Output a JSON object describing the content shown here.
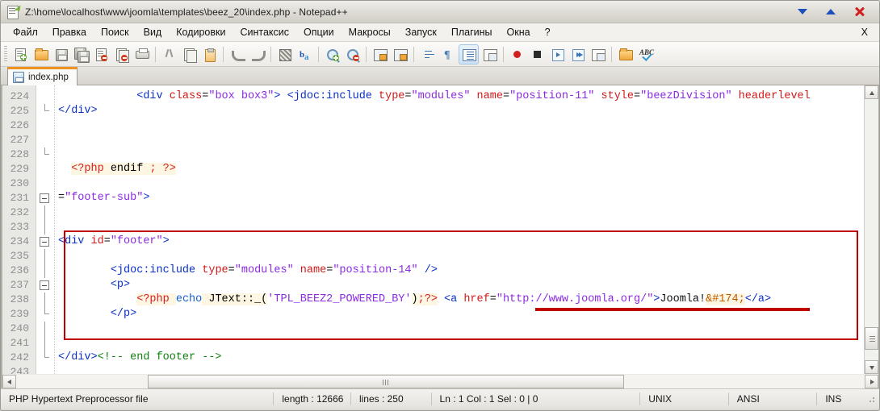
{
  "window": {
    "title": "Z:\\home\\localhost\\www\\joomla\\templates\\beez_20\\index.php - Notepad++",
    "icon": "notepad-plus-plus-icon",
    "controls": {
      "minimize": "▼",
      "maximize": "▲",
      "close": "✕"
    },
    "accent_colors": {
      "tab_active_top": "#f0921e",
      "annotation_red": "#c00000",
      "minimize_blue": "#1c4fbe",
      "close_red": "#cf2020"
    }
  },
  "menubar": {
    "items": [
      {
        "label": "Файл"
      },
      {
        "label": "Правка"
      },
      {
        "label": "Поиск"
      },
      {
        "label": "Вид"
      },
      {
        "label": "Кодировки"
      },
      {
        "label": "Синтаксис"
      },
      {
        "label": "Опции"
      },
      {
        "label": "Макросы"
      },
      {
        "label": "Запуск"
      },
      {
        "label": "Плагины"
      },
      {
        "label": "Окна"
      },
      {
        "label": "?"
      }
    ],
    "right_label": "X"
  },
  "toolbar": {
    "buttons": [
      {
        "name": "new-file-icon"
      },
      {
        "name": "open-file-icon"
      },
      {
        "name": "save-icon"
      },
      {
        "name": "save-all-icon"
      },
      {
        "name": "close-file-icon"
      },
      {
        "name": "close-all-icon"
      },
      {
        "name": "print-icon"
      },
      {
        "name": "cut-icon"
      },
      {
        "name": "copy-icon"
      },
      {
        "name": "paste-icon"
      },
      {
        "name": "undo-icon"
      },
      {
        "name": "redo-icon"
      },
      {
        "name": "find-icon"
      },
      {
        "name": "replace-icon"
      },
      {
        "name": "zoom-in-icon"
      },
      {
        "name": "zoom-out-icon"
      },
      {
        "name": "sync-vertical-icon"
      },
      {
        "name": "sync-horizontal-icon"
      },
      {
        "name": "word-wrap-icon"
      },
      {
        "name": "show-all-chars-icon"
      },
      {
        "name": "indent-guide-icon"
      },
      {
        "name": "user-defined-dialog-icon"
      },
      {
        "name": "record-macro-icon"
      },
      {
        "name": "stop-recording-icon"
      },
      {
        "name": "play-macro-icon"
      },
      {
        "name": "run-macro-multiple-icon"
      },
      {
        "name": "save-macro-icon"
      },
      {
        "name": "run-icon"
      },
      {
        "name": "spell-check-icon"
      }
    ]
  },
  "tabs": [
    {
      "label": "index.php",
      "icon": "saved-file-icon",
      "active": true
    }
  ],
  "editor": {
    "first_line": 224,
    "lines": [
      {
        "num": "224",
        "fold": "none",
        "segments": [
          {
            "t": "            ",
            "c": "k-plain"
          },
          {
            "t": "<div",
            "c": "k-tag"
          },
          {
            "t": " class",
            "c": "k-attr"
          },
          {
            "t": "=",
            "c": "k-punct"
          },
          {
            "t": "\"box box3\"",
            "c": "k-str"
          },
          {
            "t": ">",
            "c": "k-tag"
          },
          {
            "t": " ",
            "c": "k-plain"
          },
          {
            "t": "<jdoc:include",
            "c": "k-tag"
          },
          {
            "t": " type",
            "c": "k-attr"
          },
          {
            "t": "=",
            "c": "k-punct"
          },
          {
            "t": "\"modules\"",
            "c": "k-str"
          },
          {
            "t": " name",
            "c": "k-attr"
          },
          {
            "t": "=",
            "c": "k-punct"
          },
          {
            "t": "\"position-11\"",
            "c": "k-str"
          },
          {
            "t": " style",
            "c": "k-attr"
          },
          {
            "t": "=",
            "c": "k-punct"
          },
          {
            "t": "\"beezDivision\"",
            "c": "k-str"
          },
          {
            "t": " headerlevel",
            "c": "k-attr"
          }
        ]
      },
      {
        "num": "225",
        "fold": "tick",
        "segments": [
          {
            "t": "</div>",
            "c": "k-tag"
          }
        ]
      },
      {
        "num": "226",
        "fold": "none",
        "segments": []
      },
      {
        "num": "227",
        "fold": "none",
        "segments": []
      },
      {
        "num": "228",
        "fold": "tick",
        "segments": []
      },
      {
        "num": "229",
        "fold": "none",
        "segments": [
          {
            "t": "  ",
            "c": "k-plain"
          },
          {
            "t": "<?php",
            "c": "k-php"
          },
          {
            "t": " endif ",
            "c": "k-phpbg"
          },
          {
            "t": ";",
            "c": "k-php"
          },
          {
            "t": " ",
            "c": "k-phpbg"
          },
          {
            "t": "?>",
            "c": "k-php"
          }
        ]
      },
      {
        "num": "230",
        "fold": "none",
        "segments": []
      },
      {
        "num": "231",
        "fold": "box",
        "segments": [
          {
            "t": "=",
            "c": "k-punct"
          },
          {
            "t": "\"footer-sub\"",
            "c": "k-str"
          },
          {
            "t": ">",
            "c": "k-tag"
          }
        ]
      },
      {
        "num": "232",
        "fold": "line",
        "segments": []
      },
      {
        "num": "233",
        "fold": "line",
        "segments": []
      },
      {
        "num": "234",
        "fold": "box",
        "segments": [
          {
            "t": "<div",
            "c": "k-tag"
          },
          {
            "t": " id",
            "c": "k-attr"
          },
          {
            "t": "=",
            "c": "k-punct"
          },
          {
            "t": "\"footer\"",
            "c": "k-str"
          },
          {
            "t": ">",
            "c": "k-tag"
          }
        ]
      },
      {
        "num": "235",
        "fold": "line",
        "segments": []
      },
      {
        "num": "236",
        "fold": "line",
        "segments": [
          {
            "t": "        ",
            "c": "k-plain"
          },
          {
            "t": "<jdoc:include",
            "c": "k-tag"
          },
          {
            "t": " type",
            "c": "k-attr"
          },
          {
            "t": "=",
            "c": "k-punct"
          },
          {
            "t": "\"modules\"",
            "c": "k-str"
          },
          {
            "t": " name",
            "c": "k-attr"
          },
          {
            "t": "=",
            "c": "k-punct"
          },
          {
            "t": "\"position-14\"",
            "c": "k-str"
          },
          {
            "t": " />",
            "c": "k-tag"
          }
        ]
      },
      {
        "num": "237",
        "fold": "box",
        "segments": [
          {
            "t": "        ",
            "c": "k-plain"
          },
          {
            "t": "<p>",
            "c": "k-tag"
          }
        ]
      },
      {
        "num": "238",
        "fold": "line",
        "segments": [
          {
            "t": "            ",
            "c": "k-plain"
          },
          {
            "t": "<?php",
            "c": "k-php"
          },
          {
            "t": " ",
            "c": "k-phpbg"
          },
          {
            "t": "echo",
            "c": "k-kw"
          },
          {
            "t": " JText::",
            "c": "k-phpbg"
          },
          {
            "t": "_(",
            "c": "k-phpbg"
          },
          {
            "t": "'TPL_BEEZ2_POWERED_BY'",
            "c": "k-str"
          },
          {
            "t": ")",
            "c": "k-phpbg"
          },
          {
            "t": ";",
            "c": "k-php"
          },
          {
            "t": "?>",
            "c": "k-php"
          },
          {
            "t": " ",
            "c": "k-plain"
          },
          {
            "t": "<a",
            "c": "k-tag"
          },
          {
            "t": " href",
            "c": "k-attr"
          },
          {
            "t": "=",
            "c": "k-punct"
          },
          {
            "t": "\"http://www.joomla.org/\"",
            "c": "k-str"
          },
          {
            "t": ">",
            "c": "k-tag"
          },
          {
            "t": "Joomla!",
            "c": "k-plain"
          },
          {
            "t": "&#174;",
            "c": "k-ent"
          },
          {
            "t": "</a>",
            "c": "k-tag"
          }
        ]
      },
      {
        "num": "239",
        "fold": "tick",
        "segments": [
          {
            "t": "        ",
            "c": "k-plain"
          },
          {
            "t": "</p>",
            "c": "k-tag"
          }
        ]
      },
      {
        "num": "240",
        "fold": "line",
        "segments": []
      },
      {
        "num": "241",
        "fold": "line",
        "segments": []
      },
      {
        "num": "242",
        "fold": "tick",
        "segments": [
          {
            "t": "</div>",
            "c": "k-tag"
          },
          {
            "t": "<!-- end footer -->",
            "c": "k-com"
          }
        ]
      },
      {
        "num": "243",
        "fold": "none",
        "segments": []
      }
    ],
    "annotations": [
      {
        "name": "footer-block-highlight-box",
        "type": "box"
      },
      {
        "name": "joomla-link-underline",
        "type": "underline"
      }
    ]
  },
  "statusbar": {
    "file_type": "PHP Hypertext Preprocessor file",
    "length": "length : 12666",
    "lines": "lines : 250",
    "position": "Ln : 1    Col : 1    Sel : 0 | 0",
    "eol": "UNIX",
    "encoding": "ANSI",
    "insert_mode": "INS"
  }
}
